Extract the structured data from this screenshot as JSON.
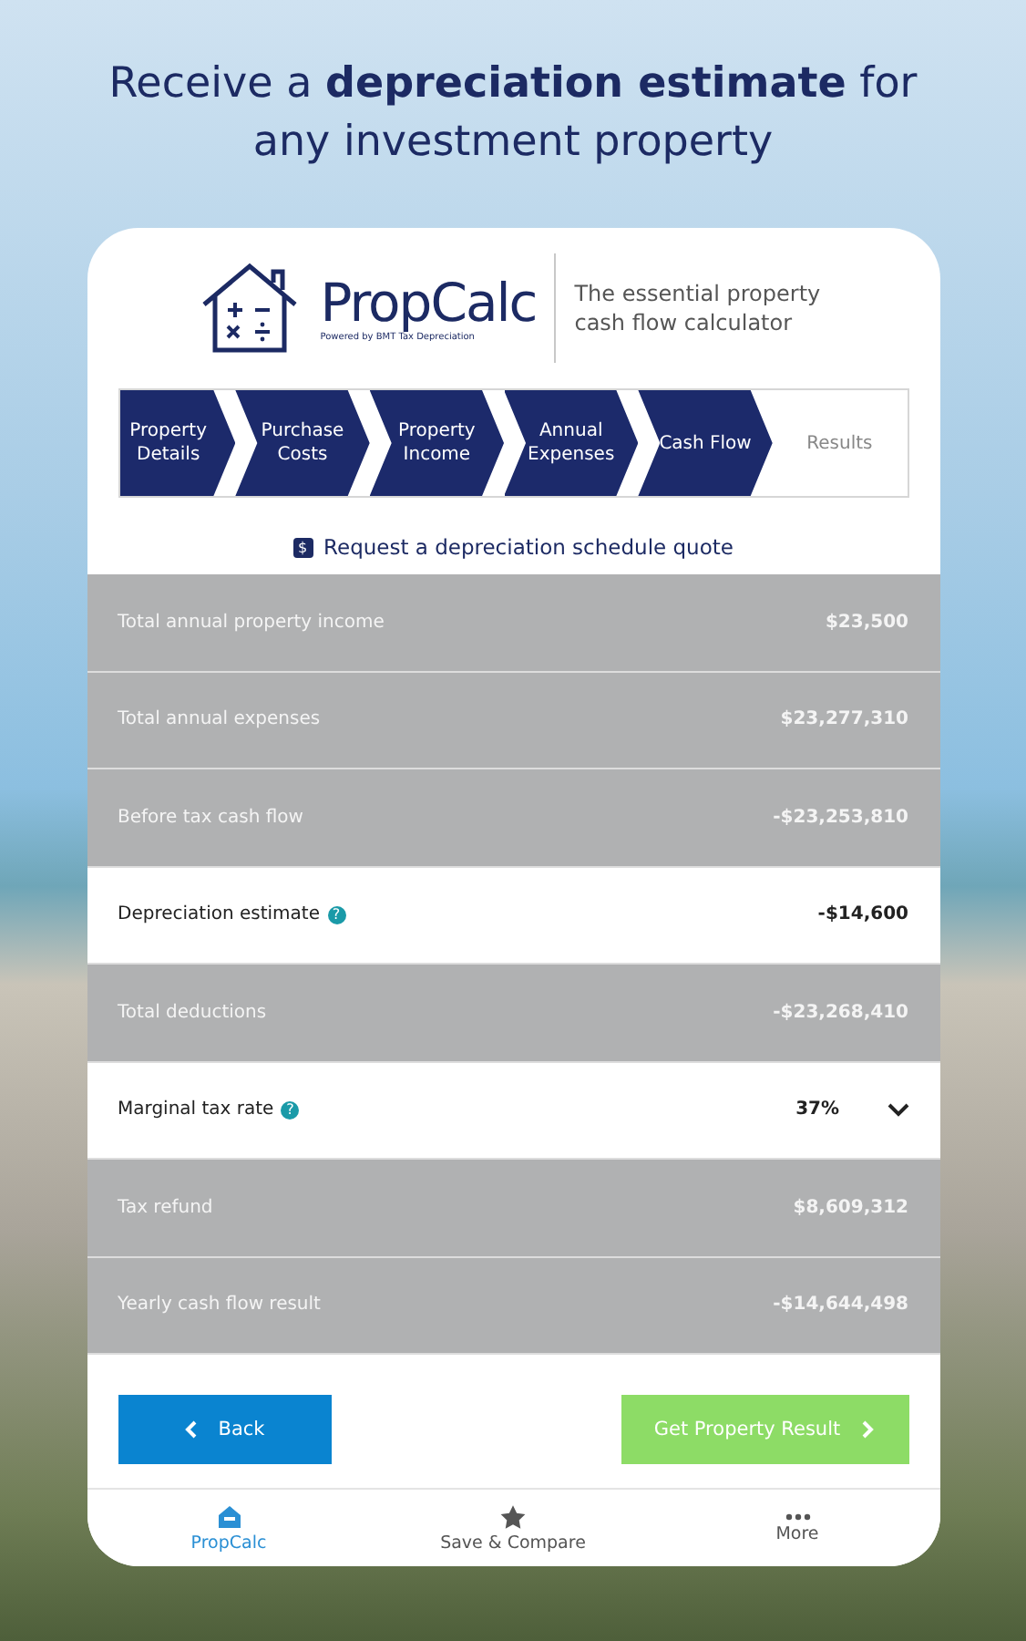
{
  "headline": "Receive a **depreciation estimate** for any investment property",
  "logo": {
    "name": "PropCalc",
    "powered_by": "Powered by BMT Tax Depreciation",
    "tagline": "The essential property cash flow calculator"
  },
  "steps": [
    {
      "label": "Property Details",
      "completed": true
    },
    {
      "label": "Purchase Costs",
      "completed": true
    },
    {
      "label": "Property Income",
      "completed": true
    },
    {
      "label": "Annual Expenses",
      "completed": true
    },
    {
      "label": "Cash Flow",
      "completed": true
    },
    {
      "label": "Results",
      "completed": false
    }
  ],
  "quote_link": {
    "icon_text": "$",
    "label": "Request a depreciation schedule quote"
  },
  "rows": [
    {
      "kind": "summary",
      "label": "Total annual property income",
      "value": "$23,500",
      "help": false
    },
    {
      "kind": "summary",
      "label": "Total annual expenses",
      "value": "$23,277,310",
      "help": false
    },
    {
      "kind": "summary",
      "label": "Before tax cash flow",
      "value": "-$23,253,810",
      "help": false
    },
    {
      "kind": "plain",
      "label": "Depreciation estimate",
      "value": "-$14,600",
      "help": true,
      "help_icon": "?"
    },
    {
      "kind": "summary",
      "label": "Total deductions",
      "value": "-$23,268,410",
      "help": false
    },
    {
      "kind": "select",
      "label": "Marginal tax rate",
      "value": "37%",
      "help": true,
      "help_icon": "?"
    },
    {
      "kind": "summary",
      "label": "Tax refund",
      "value": "$8,609,312",
      "help": false
    },
    {
      "kind": "summary",
      "label": "Yearly cash flow result",
      "value": "-$14,644,498",
      "help": false
    }
  ],
  "buttons": {
    "back": "Back",
    "next": "Get Property Result"
  },
  "nav": [
    {
      "label": "PropCalc",
      "selected": true
    },
    {
      "label": "Save & Compare",
      "selected": false
    },
    {
      "label": "More",
      "selected": false
    }
  ]
}
